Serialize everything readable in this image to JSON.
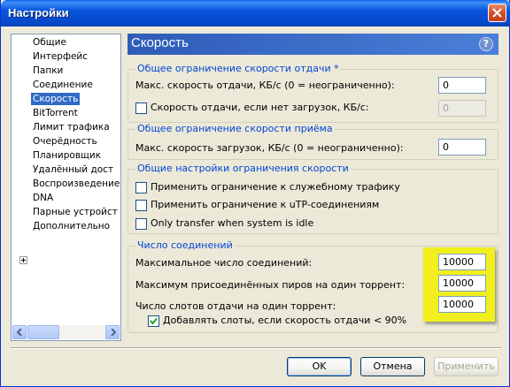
{
  "window": {
    "title": "Настройки"
  },
  "tree": {
    "items": [
      {
        "label": "Общие"
      },
      {
        "label": "Интерфейс"
      },
      {
        "label": "Папки"
      },
      {
        "label": "Соединение"
      },
      {
        "label": "Скорость",
        "selected": true
      },
      {
        "label": "BitTorrent"
      },
      {
        "label": "Лимит трафика"
      },
      {
        "label": "Очерёдность"
      },
      {
        "label": "Планировщик"
      },
      {
        "label": "Удалённый дост"
      },
      {
        "label": "Воспроизведение"
      },
      {
        "label": "DNA"
      },
      {
        "label": "Парные устройст"
      },
      {
        "label": "Дополнительно"
      }
    ]
  },
  "panel": {
    "title": "Скорость",
    "help": "?"
  },
  "upload": {
    "legend": "Общее ограничение скорости отдачи *",
    "max_label": "Макс. скорость отдачи, КБ/с (0 = неограниченно):",
    "max_value": "0",
    "no_download_label": "Скорость отдачи, если нет загрузок, КБ/с:",
    "no_download_checked": false,
    "no_download_value": "0"
  },
  "download": {
    "legend": "Общее ограничение скорости приёма",
    "max_label": "Макс. скорость загрузок, КБ/с (0 = неограниченно):",
    "max_value": "0"
  },
  "general": {
    "legend": "Общие настройки ограничения скорости",
    "opt1": "Применить ограничение к служебному трафику",
    "opt1_checked": false,
    "opt2": "Применить ограничение к uTP-соединениям",
    "opt2_checked": false,
    "opt3": "Only transfer when system is idle",
    "opt3_checked": false
  },
  "connections": {
    "legend": "Число соединений",
    "max_conn_label": "Максимальное число соединений:",
    "max_conn_value": "10000",
    "max_peers_label": "Максимум присоединённых пиров на один торрент:",
    "max_peers_value": "10000",
    "slots_label": "Число слотов отдачи на один торрент:",
    "slots_value": "10000",
    "add_slots_label": "Добавлять слоты, если скорость отдачи < 90%",
    "add_slots_checked": true,
    "highlight_color": "#f2ef1e"
  },
  "buttons": {
    "ok": "OK",
    "cancel": "Отмена",
    "apply": "Применить"
  }
}
